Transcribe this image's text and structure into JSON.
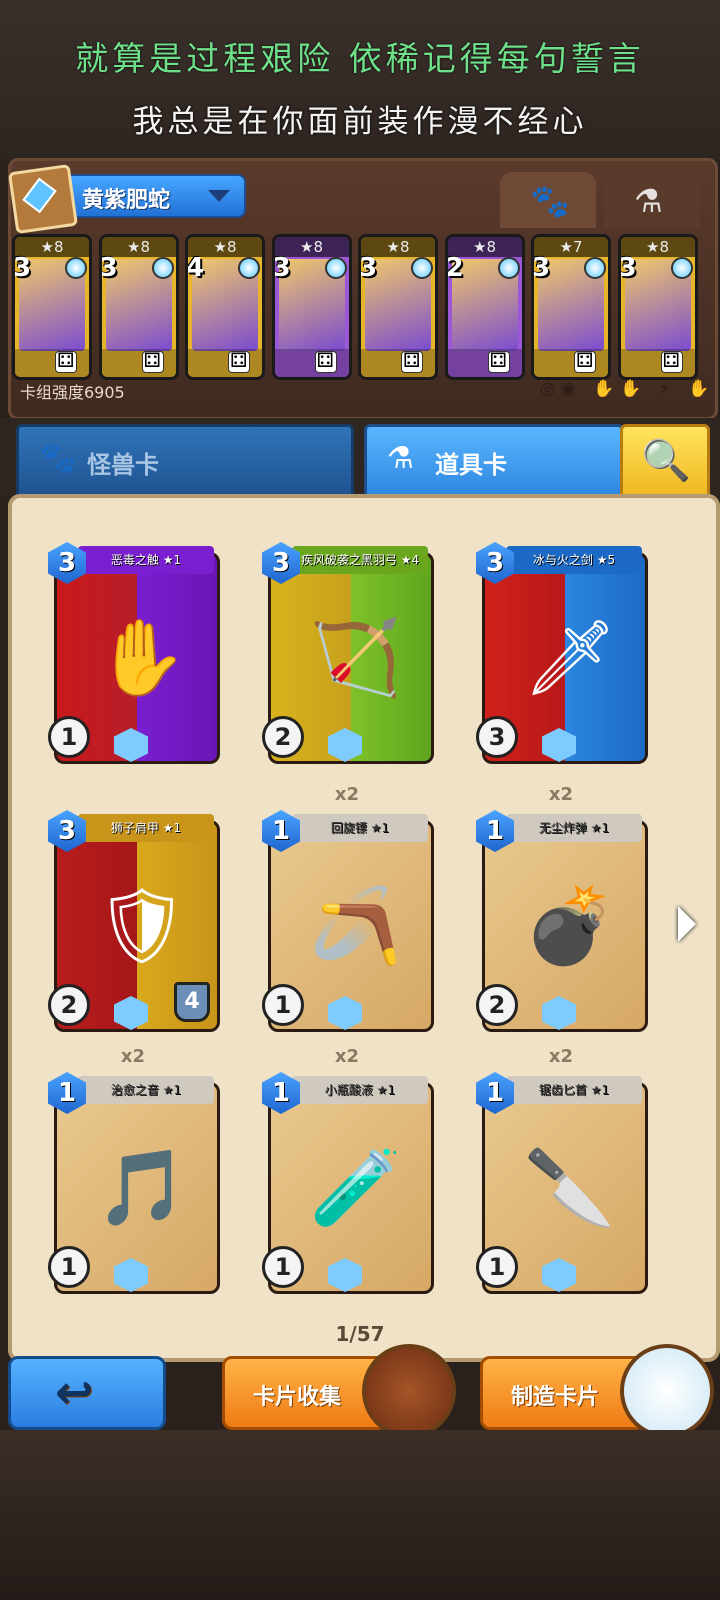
{
  "lyrics": {
    "line1": "就算是过程艰险 依稀记得每句誓言",
    "line2": "我总是在你面前装作漫不经心"
  },
  "deck": {
    "name": "黄紫肥蛇",
    "power_label": "卡组强度6905",
    "filters_label": "◎◉ ✋✋ ⚡ ✋",
    "cards": [
      {
        "stars": "★8",
        "cost": "3",
        "color": "#e7b52a"
      },
      {
        "stars": "★8",
        "cost": "3",
        "color": "#e7b52a"
      },
      {
        "stars": "★8",
        "cost": "4",
        "color": "#e7b52a"
      },
      {
        "stars": "★8",
        "cost": "3",
        "color": "#9b57d6"
      },
      {
        "stars": "★8",
        "cost": "3",
        "color": "#e7b52a"
      },
      {
        "stars": "★8",
        "cost": "2",
        "color": "#9b57d6"
      },
      {
        "stars": "★7",
        "cost": "3",
        "color": "#e7b52a"
      },
      {
        "stars": "★8",
        "cost": "3",
        "color": "#e7b52a"
      }
    ]
  },
  "tabs": {
    "monster_icon": "🐾",
    "item_icon": "⚗"
  },
  "categories": {
    "monster": "怪兽卡",
    "item": "道具卡"
  },
  "cards": [
    {
      "name": "恶毒之触 ★1",
      "cost": "3",
      "atk": "1",
      "copies": "",
      "bg": "linear-gradient(90deg,#c8191b,#b71e2a 50%,#7a1fd0 50%,#6a16b5)",
      "ribbon": "#7a1fd0",
      "glyph": "✋"
    },
    {
      "name": "疾风破袭之黑羽弓 ★4",
      "cost": "3",
      "atk": "2",
      "copies": "",
      "bg": "linear-gradient(90deg,#d8b21d,#c7a11c 50%,#7ec22a 50%,#5fa61d)",
      "ribbon": "#6aa61e",
      "glyph": "🏹",
      "rune": "1"
    },
    {
      "name": "冰与火之剑 ★5",
      "cost": "3",
      "atk": "3",
      "copies": "",
      "bg": "linear-gradient(90deg,#d0211b,#b8191a 50%,#2a86e0 50%,#1c6ac5)",
      "ribbon": "#1c6ac5",
      "glyph": "🗡",
      "extra": "3"
    },
    {
      "name": "狮子肩甲 ★1",
      "cost": "3",
      "atk": "2",
      "hp": "4",
      "copies": "",
      "bg": "linear-gradient(90deg,#b81c1c,#a5171a 50%,#d9a91c 50%,#c8941a)",
      "ribbon": "#c8941a",
      "glyph": "🛡",
      "rune": "1"
    },
    {
      "name": "回旋镖 ★1",
      "cost": "1",
      "atk": "1",
      "copies": "x2",
      "bg": "",
      "ribbon": "#cfc9c0",
      "glyph": "🪃"
    },
    {
      "name": "无尘炸弹 ★1",
      "cost": "1",
      "atk": "2",
      "copies": "x2",
      "bg": "",
      "ribbon": "#cfc9c0",
      "glyph": "💣"
    },
    {
      "name": "治愈之音 ★1",
      "cost": "1",
      "atk": "1",
      "copies": "x2",
      "bg": "",
      "ribbon": "#cfc9c0",
      "glyph": "🎵"
    },
    {
      "name": "小瓶酸液 ★1",
      "cost": "1",
      "atk": "1",
      "copies": "x2",
      "bg": "",
      "ribbon": "#cfc9c0",
      "glyph": "🧪",
      "rune": "1"
    },
    {
      "name": "锯齿匕首 ★1",
      "cost": "1",
      "atk": "1",
      "copies": "x2",
      "bg": "",
      "ribbon": "#cfc9c0",
      "glyph": "🔪"
    }
  ],
  "pagination": {
    "label": "1/57"
  },
  "buttons": {
    "back_icon": "↩",
    "collection": "卡片收集",
    "craft": "制造卡片"
  }
}
